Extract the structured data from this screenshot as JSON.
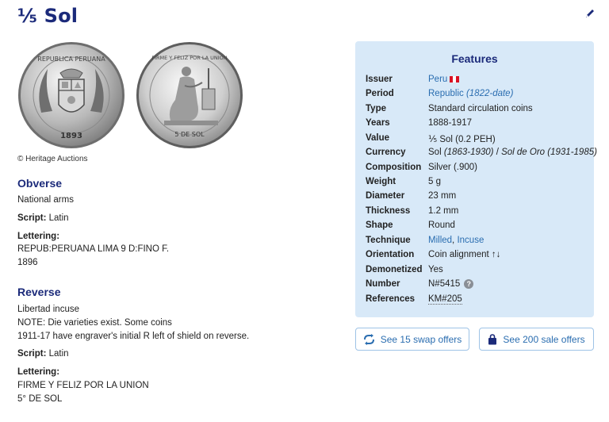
{
  "page": {
    "title": "⅕ Sol",
    "image_credit": "© Heritage Auctions"
  },
  "obverse": {
    "heading": "Obverse",
    "description": "National arms",
    "script_label": "Script:",
    "script_value": "Latin",
    "lettering_label": "Lettering:",
    "lettering_lines": [
      "REPUB:PERUANA LIMA 9 D:FINO F.",
      "1896"
    ],
    "coin_legend_top": "REPUBLICA PERUANA",
    "coin_legend_bottom": "1893"
  },
  "reverse": {
    "heading": "Reverse",
    "description_lines": [
      "Libertad incuse",
      "NOTE: Die varieties exist. Some coins",
      "1911-17 have engraver's initial R left of shield on reverse."
    ],
    "script_label": "Script:",
    "script_value": "Latin",
    "lettering_label": "Lettering:",
    "lettering_lines": [
      "FIRME Y FELIZ POR LA UNION",
      "5° DE SOL"
    ],
    "coin_legend_top": "FIRME Y FELIZ POR LA UNION",
    "coin_legend_bottom": "5 DE SOL"
  },
  "features": {
    "heading": "Features",
    "issuer": {
      "label": "Issuer",
      "value": "Peru"
    },
    "period": {
      "label": "Period",
      "value": "Republic",
      "range": "(1822-date)"
    },
    "type": {
      "label": "Type",
      "value": "Standard circulation coins"
    },
    "years": {
      "label": "Years",
      "value": "1888-1917"
    },
    "value": {
      "label": "Value",
      "value": "⅕ Sol (0.2 PEH)"
    },
    "currency": {
      "label": "Currency",
      "value1": "Sol",
      "range1": "(1863-1930)",
      "sep": "/",
      "value2": "Sol de Oro",
      "range2": "(1931-1985)"
    },
    "composition": {
      "label": "Composition",
      "value": "Silver (.900)"
    },
    "weight": {
      "label": "Weight",
      "value": "5 g"
    },
    "diameter": {
      "label": "Diameter",
      "value": "23 mm"
    },
    "thickness": {
      "label": "Thickness",
      "value": "1.2 mm"
    },
    "shape": {
      "label": "Shape",
      "value": "Round"
    },
    "technique": {
      "label": "Technique",
      "value1": "Milled",
      "sep": ",",
      "value2": "Incuse"
    },
    "orientation": {
      "label": "Orientation",
      "value": "Coin alignment ↑↓"
    },
    "demonetized": {
      "label": "Demonetized",
      "value": "Yes"
    },
    "number": {
      "label": "Number",
      "value": "N#5415",
      "help": "?"
    },
    "references": {
      "label": "References",
      "value": "KM#205"
    }
  },
  "actions": {
    "swap_label": "See 15 swap offers",
    "sale_label": "See 200 sale offers"
  },
  "colors": {
    "title": "#1b2a7a",
    "link": "#2a6db0",
    "panel_bg": "#d8e9f8"
  }
}
